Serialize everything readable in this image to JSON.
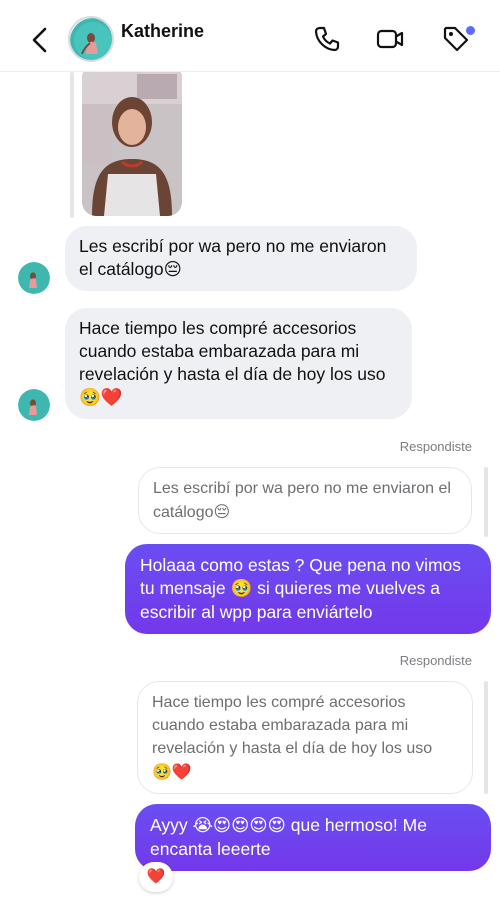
{
  "header": {
    "title": "Katherine",
    "back_icon": "back-chevron-icon",
    "call_icon": "phone-icon",
    "video_icon": "video-camera-icon",
    "tag_icon": "tag-icon",
    "dot_color": "#5b6cf9"
  },
  "colors": {
    "outgoing": "#7338ea",
    "incoming": "#eff0f3",
    "meta": "#7c7d82"
  },
  "messages": {
    "in1": {
      "text": "Les escribí por wa pero no me enviaron el catálogo",
      "emoji": "😔"
    },
    "in2": {
      "text": "Hace tiempo les compré accesorios cuando estaba embarazada para mi revelación y hasta el día de hoy los uso",
      "emoji": "🥹❤️"
    },
    "meta1": "Respondiste",
    "reply1": {
      "text": "Les escribí por wa pero no me enviaron el catálogo",
      "emoji": "😔"
    },
    "out1": {
      "text_a": "Holaaa como estas ? Que pena no vimos tu mensaje",
      "emoji": "🥹",
      "text_b": "si quieres me vuelves a escribir al wpp para enviártelo"
    },
    "meta2": "Respondiste",
    "reply2": {
      "text": "Hace tiempo les compré accesorios cuando estaba embarazada para mi revelación y hasta el día de hoy los uso",
      "emoji": "🥹❤️"
    },
    "out2": {
      "text_a": "Ayyy",
      "emoji": "😭😍😍😍😍",
      "text_b": "que hermoso! Me encanta leeerte"
    },
    "reaction": "❤️"
  }
}
